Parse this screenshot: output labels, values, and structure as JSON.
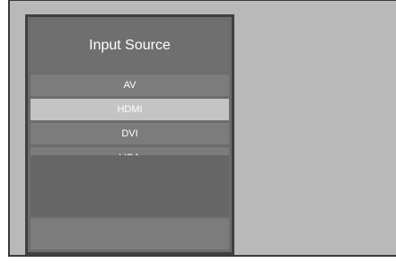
{
  "menu": {
    "title": "Input Source",
    "items": [
      {
        "label": "AV",
        "selected": false
      },
      {
        "label": "HDMI",
        "selected": true
      },
      {
        "label": "DVI",
        "selected": false
      },
      {
        "label": "VGA",
        "selected": false
      }
    ]
  },
  "colors": {
    "screen_background": "#b9b9b9",
    "panel_border": "#404040",
    "item_background": "#7c7c7c",
    "selected_background": "#c4c4c4",
    "text": "#ffffff"
  }
}
